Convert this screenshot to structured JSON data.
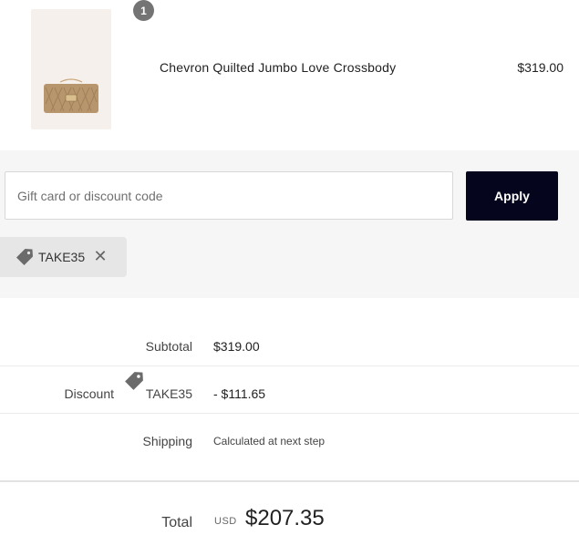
{
  "product": {
    "quantity": "1",
    "name": "Chevron Quilted Jumbo Love Crossbody",
    "price": "$319.00",
    "image_icon": "handbag-thumbnail"
  },
  "discount_form": {
    "placeholder": "Gift card or discount code",
    "value": "",
    "apply_label": "Apply",
    "applied_code": "TAKE35",
    "tag_icon": "tag-icon",
    "remove_icon": "close-icon"
  },
  "summary": {
    "subtotal_label": "Subtotal",
    "subtotal_value": "$319.00",
    "discount_label": "Discount",
    "discount_code": "TAKE35",
    "discount_value": "- $111.65",
    "shipping_label": "Shipping",
    "shipping_value": "Calculated at next step",
    "total_label": "Total",
    "currency": "USD",
    "total_value": "$207.35"
  },
  "colors": {
    "apply_button": "#05051e",
    "section_bg": "#f6f6f6",
    "badge": "#747474"
  }
}
